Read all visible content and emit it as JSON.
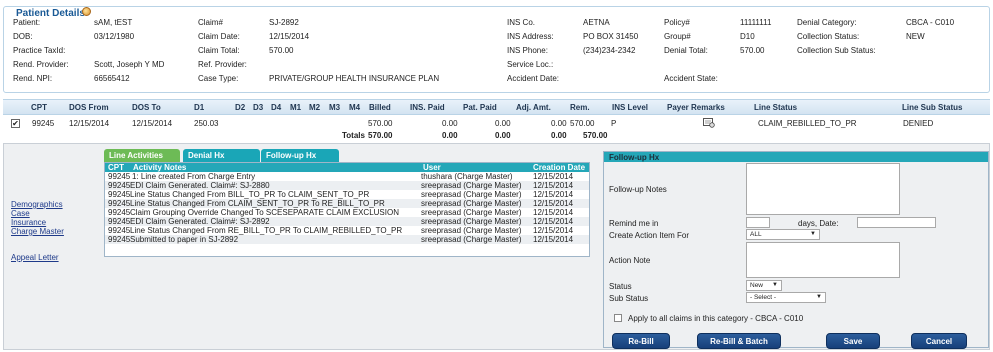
{
  "patient_details": {
    "title": "Patient Details",
    "fields": [
      {
        "label": "Patient:",
        "value": "sAM, tEST"
      },
      {
        "label": "DOB:",
        "value": "03/12/1980"
      },
      {
        "label": "Practice TaxId:",
        "value": ""
      },
      {
        "label": "Rend. Provider:",
        "value": "Scott, Joseph Y MD"
      },
      {
        "label": "Rend. NPI:",
        "value": "66565412"
      },
      {
        "label": "Claim#",
        "value": "SJ-2892"
      },
      {
        "label": "Claim Date:",
        "value": "12/15/2014"
      },
      {
        "label": "Claim Total:",
        "value": "570.00"
      },
      {
        "label": "Ref. Provider:",
        "value": ""
      },
      {
        "label": "Case Type:",
        "value": "PRIVATE/GROUP HEALTH INSURANCE PLAN"
      },
      {
        "label": "INS Co.",
        "value": "AETNA"
      },
      {
        "label": "INS Address:",
        "value": "PO BOX 31450"
      },
      {
        "label": "INS Phone:",
        "value": "(234)234-2342"
      },
      {
        "label": "Service Loc.:",
        "value": ""
      },
      {
        "label": "Accident Date:",
        "value": ""
      },
      {
        "label": "Policy#",
        "value": "11111111"
      },
      {
        "label": "Group#",
        "value": "D10"
      },
      {
        "label": "Denial Total:",
        "value": "570.00"
      },
      {
        "label": "Accident State:",
        "value": ""
      },
      {
        "label": "Denial Category:",
        "value": "CBCA - C010"
      },
      {
        "label": "Collection Status:",
        "value": "NEW"
      },
      {
        "label": "Collection Sub Status:",
        "value": ""
      }
    ]
  },
  "grid": {
    "headers": [
      "CPT",
      "DOS From",
      "DOS To",
      "D1",
      "D2",
      "D3",
      "D4",
      "M1",
      "M2",
      "M3",
      "M4",
      "Billed",
      "INS. Paid",
      "Pat. Paid",
      "Adj. Amt.",
      "Rem.",
      "INS Level",
      "Payer Remarks",
      "Line Status",
      "Line Sub Status"
    ],
    "row": {
      "checked": "✔",
      "cpt": "99245",
      "dos_from": "12/15/2014",
      "dos_to": "12/15/2014",
      "d1": "250.03",
      "billed": "570.00",
      "ins_paid": "0.00",
      "pat_paid": "0.00",
      "adj_amt": "0.00",
      "rem": "570.00",
      "ins_level": "P",
      "line_status": "CLAIM_REBILLED_TO_PR",
      "line_sub_status": "DENIED"
    },
    "totals": {
      "label": "Totals",
      "billed": "570.00",
      "ins_paid": "0.00",
      "pat_paid": "0.00",
      "adj_amt": "0.00",
      "rem": "570.00"
    }
  },
  "left_links": [
    "Demographics",
    "Case",
    "Insurance",
    "Charge Master",
    "Appeal Letter"
  ],
  "tabs": [
    "Line Activities",
    "Denial Hx",
    "Follow-up Hx"
  ],
  "activities": {
    "headers": [
      "CPT",
      "Activity Notes",
      "User",
      "Creation Date"
    ],
    "rows": [
      {
        "cpt": "99245",
        "note": "1: Line created From Charge Entry",
        "user": "thushara (Charge Master)",
        "date": "12/15/2014"
      },
      {
        "cpt": "99245",
        "note": "EDI Claim Generated. Claim#: SJ-2880",
        "user": "sreeprasad (Charge Master)",
        "date": "12/15/2014"
      },
      {
        "cpt": "99245",
        "note": "Line Status Changed From BILL_TO_PR To CLAIM_SENT_TO_PR",
        "user": "sreeprasad (Charge Master)",
        "date": "12/15/2014"
      },
      {
        "cpt": "99245",
        "note": "Line Status Changed From CLAIM_SENT_TO_PR To RE_BILL_TO_PR",
        "user": "sreeprasad (Charge Master)",
        "date": "12/15/2014"
      },
      {
        "cpt": "99245",
        "note": "Claim Grouping Override Changed To SCESEPARATE CLAIM EXCLUSION",
        "user": "sreeprasad (Charge Master)",
        "date": "12/15/2014"
      },
      {
        "cpt": "99245",
        "note": "EDI Claim Generated. Claim#: SJ-2892",
        "user": "sreeprasad (Charge Master)",
        "date": "12/15/2014"
      },
      {
        "cpt": "99245",
        "note": "Line Status Changed From RE_BILL_TO_PR To CLAIM_REBILLED_TO_PR",
        "user": "sreeprasad (Charge Master)",
        "date": "12/15/2014"
      },
      {
        "cpt": "99245",
        "note": "Submitted to paper in SJ-2892",
        "user": "sreeprasad (Charge Master)",
        "date": "12/15/2014"
      }
    ]
  },
  "followup": {
    "title": "Follow-up Hx",
    "notes_label": "Follow-up Notes",
    "remind_label": "Remind me in",
    "days_label": "days, Date:",
    "action_for_label": "Create Action Item For",
    "action_for_value": "ALL",
    "action_note_label": "Action Note",
    "status_label": "Status",
    "status_value": "New",
    "sub_status_label": "Sub Status",
    "sub_status_value": "- Select -",
    "apply_text": "Apply to all claims in this category - CBCA - C010",
    "buttons": [
      "Re-Bill",
      "Re-Bill & Batch",
      "Save",
      "Cancel"
    ]
  }
}
